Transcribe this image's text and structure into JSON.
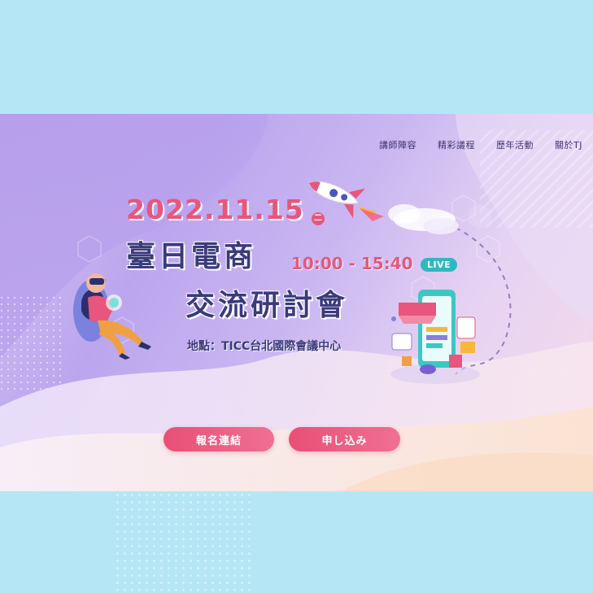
{
  "nav": {
    "items": [
      "講師陣容",
      "精彩議程",
      "歷年活動",
      "關於TJ"
    ]
  },
  "event": {
    "date": "2022.11.15",
    "weekday": "二",
    "title_line1": "臺日電商",
    "title_line2": "交流研討會",
    "time": "10:00 - 15:40",
    "live_badge": "LIVE",
    "venue": "地點：TICC台北國際會議中心"
  },
  "buttons": {
    "register": "報名連結",
    "apply": "申し込み"
  },
  "colors": {
    "accent": "#e8567d",
    "title": "#3a3a7c",
    "live": "#2fb8c0",
    "page_bg": "#b5e6f6"
  },
  "icons": [
    "rocket-icon",
    "vr-woman-illustration",
    "mobile-shop-illustration"
  ]
}
